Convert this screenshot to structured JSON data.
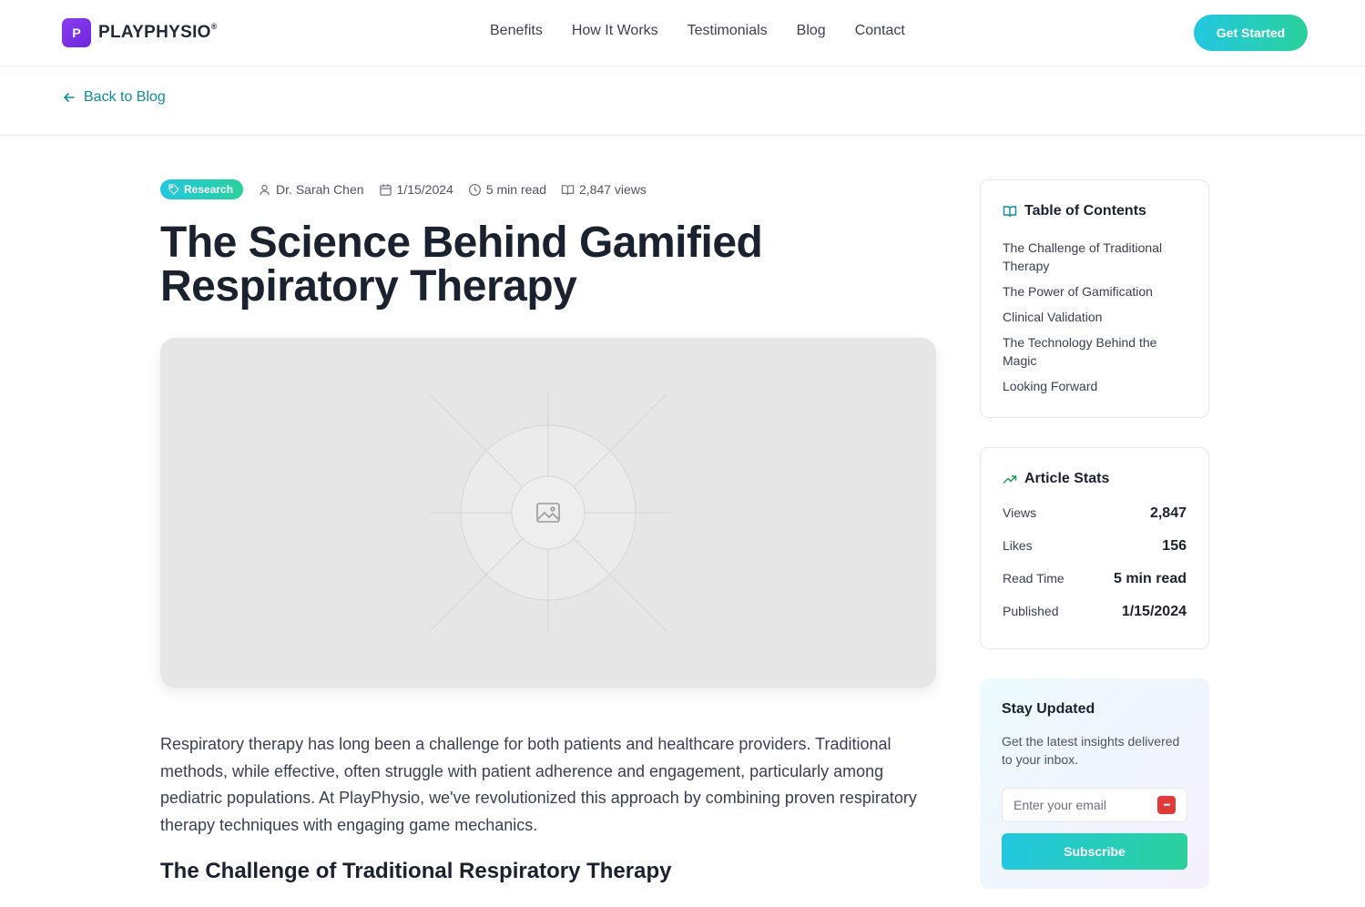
{
  "brand": {
    "initial": "P",
    "name": "PLAYPHYSIO",
    "mark": "®"
  },
  "nav": [
    "Benefits",
    "How It Works",
    "Testimonials",
    "Blog",
    "Contact"
  ],
  "header": {
    "cta_label": "Get Started"
  },
  "back": {
    "label": "Back to Blog",
    "icon": "arrow-left-icon"
  },
  "article": {
    "tag": "Research",
    "author": "Dr. Sarah Chen",
    "date": "1/15/2024",
    "read_time": "5 min read",
    "views": "2,847 views",
    "title": "The Science Behind Gamified Respiratory Therapy",
    "intro": "Respiratory therapy has long been a challenge for both patients and healthcare providers. Traditional methods, while effective, often struggle with patient adherence and engagement, particularly among pediatric populations. At PlayPhysio, we've revolutionized this approach by combining proven respiratory therapy techniques with engaging game mechanics.",
    "section_heading": "The Challenge of Traditional Respiratory Therapy"
  },
  "toc": {
    "title": "Table of Contents",
    "items": [
      "The Challenge of Traditional Therapy",
      "The Power of Gamification",
      "Clinical Validation",
      "The Technology Behind the Magic",
      "Looking Forward"
    ]
  },
  "stats": {
    "title": "Article Stats",
    "rows": [
      {
        "label": "Views",
        "value": "2,847"
      },
      {
        "label": "Likes",
        "value": "156"
      },
      {
        "label": "Read Time",
        "value": "5 min read"
      },
      {
        "label": "Published",
        "value": "1/15/2024"
      }
    ]
  },
  "newsletter": {
    "title": "Stay Updated",
    "desc": "Get the latest insights delivered to your inbox.",
    "placeholder": "Enter your email",
    "button": "Subscribe"
  },
  "colors": {
    "brand_purple": "#7c3aed",
    "accent_teal": "#0e8aa3",
    "gradient_start": "#22c7e0",
    "gradient_end": "#2ad19b"
  }
}
